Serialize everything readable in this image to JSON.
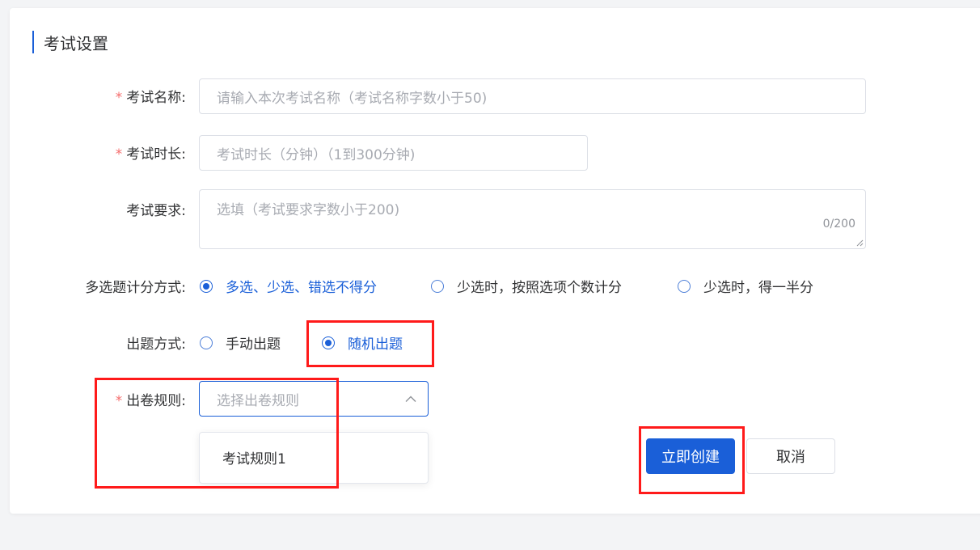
{
  "section": {
    "title": "考试设置"
  },
  "form": {
    "required_mark": "*",
    "name": {
      "label": "考试名称:",
      "placeholder": "请输入本次考试名称（考试名称字数小于50)"
    },
    "duration": {
      "label": "考试时长:",
      "placeholder": "考试时长（分钟）（1到300分钟)"
    },
    "requirement": {
      "label": "考试要求:",
      "placeholder": "选填（考试要求字数小于200)",
      "counter": "0/200"
    },
    "scoring": {
      "label": "多选题计分方式:",
      "options": [
        "多选、少选、错选不得分",
        "少选时，按照选项个数计分",
        "少选时，得一半分"
      ],
      "selected": "多选、少选、错选不得分"
    },
    "question_mode": {
      "label": "出题方式:",
      "options": [
        "手动出题",
        "随机出题"
      ],
      "selected": "随机出题"
    },
    "paper_rule": {
      "label": "出卷规则:",
      "placeholder": "选择出卷规则",
      "dropdown_items": [
        "考试规则1"
      ]
    }
  },
  "actions": {
    "create": "立即创建",
    "cancel": "取消"
  },
  "colors": {
    "primary": "#1a5fd8",
    "required": "#f56c6c",
    "highlight": "#ff1a1a"
  }
}
